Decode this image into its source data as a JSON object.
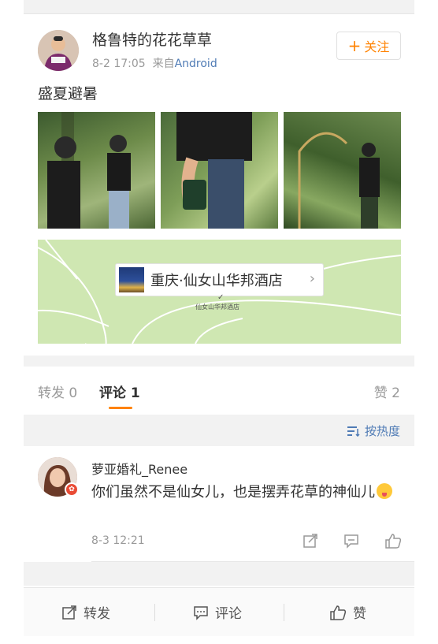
{
  "post": {
    "username": "格鲁特的花花草草",
    "time": "8-2 17:05",
    "source_prefix": "来自",
    "source": "Android",
    "follow_label": "关注",
    "text": "盛夏避暑"
  },
  "location": {
    "name": "重庆·仙女山华邦酒店",
    "map_label": "仙女山华邦酒店"
  },
  "tabs": {
    "repost": "转发 0",
    "comment": "评论 1",
    "like": "赞 2"
  },
  "sort": {
    "label": "按热度"
  },
  "comment": {
    "username": "萝亚婚礼_Renee",
    "text": "你们虽然不是仙女儿，也是摆弄花草的神仙儿",
    "time": "8-3 12:21"
  },
  "toolbar": {
    "repost": "转发",
    "comment": "评论",
    "like": "赞"
  },
  "colors": {
    "accent": "#ff8200",
    "link": "#4f7bb5",
    "map": "#cfe7b2"
  }
}
